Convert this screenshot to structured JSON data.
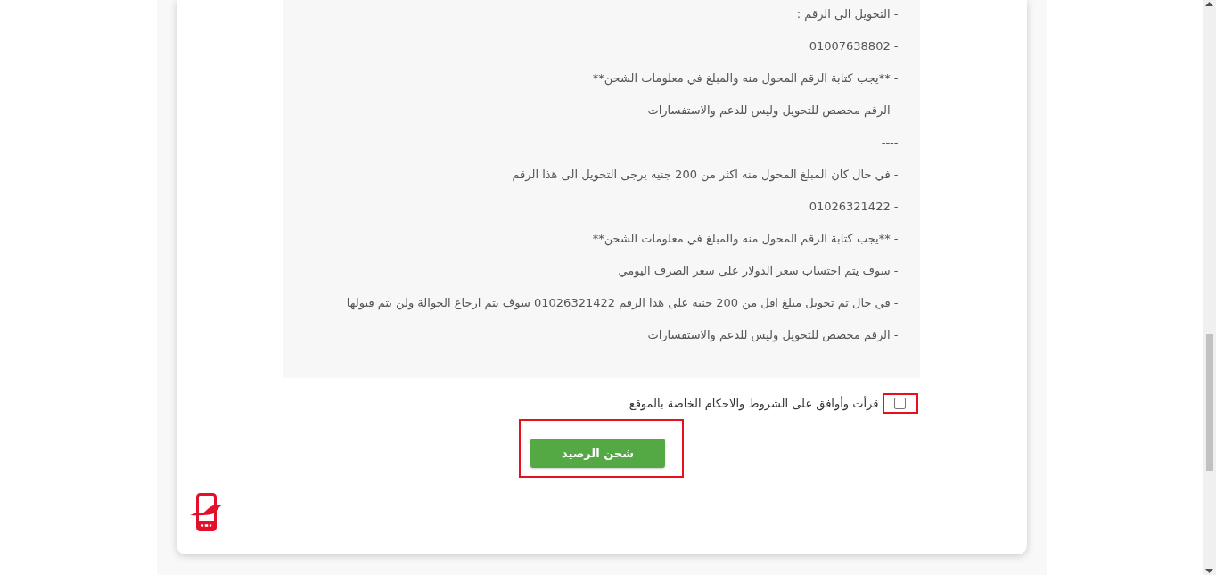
{
  "instructions": {
    "lines": [
      "- التحويل الى الرقم :",
      "- 01007638802",
      "- **يجب كتابة الرقم المحول منه والمبلغ في معلومات الشحن**",
      "- الرقم مخصص للتحويل وليس للدعم والاستفسارات",
      "----",
      "- في حال كان المبلغ المحول منه اكثر من 200 جنيه يرجى التحويل الى هذا الرقم",
      "- 01026321422",
      "- **يجب كتابة الرقم المحول منه والمبلغ في معلومات الشحن**",
      "- سوف يتم احتساب سعر الدولار على سعر الصرف اليومي",
      "- في حال تم تحويل مبلغ اقل من 200 جنيه على هذا الرقم 01026321422 سوف يتم ارجاع الحوالة ولن يتم قبولها",
      "- الرقم مخصص للتحويل وليس للدعم والاستفسارات"
    ]
  },
  "terms": {
    "label": "قرأت وأوافق على الشروط والاحكام الخاصة بالموقع",
    "checked": false,
    "highlighted": true
  },
  "submit_button": {
    "label": "شحن الرصيد",
    "highlighted": true
  }
}
